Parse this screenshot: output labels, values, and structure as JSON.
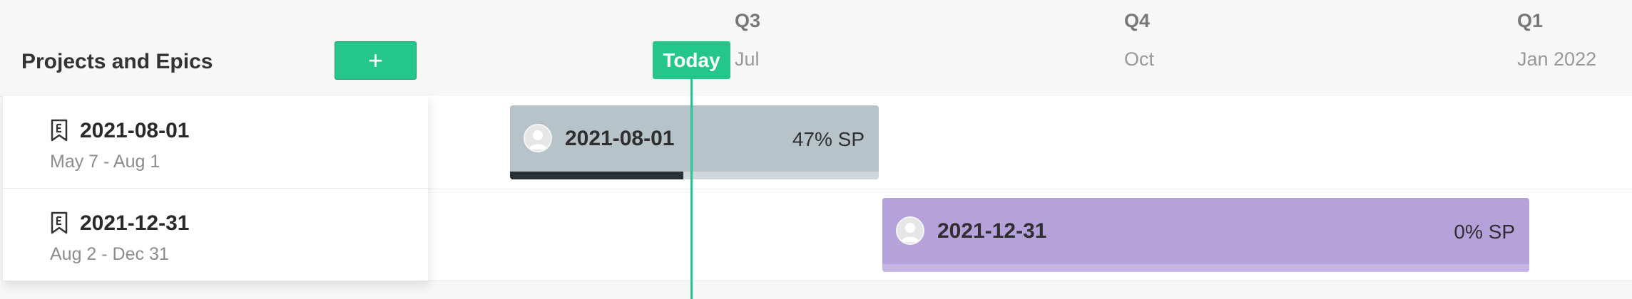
{
  "panel": {
    "title": "Projects and Epics",
    "add_label": "+"
  },
  "timeline": {
    "quarters": [
      {
        "label": "Q3",
        "month": "Jul"
      },
      {
        "label": "Q4",
        "month": "Oct"
      },
      {
        "label": "Q1",
        "month": "Jan 2022"
      }
    ],
    "today_label": "Today"
  },
  "epics": [
    {
      "name": "2021-08-01",
      "dates": "May 7 - Aug 1",
      "icon": "epic-bookmark-icon",
      "bar_label": "2021-08-01",
      "sp_text": "47% SP",
      "progress": 0.47,
      "bar_color": "#b6c3c9",
      "track_color": "#cfd7db",
      "fill_color": "#2a3033"
    },
    {
      "name": "2021-12-31",
      "dates": "Aug 2 - Dec 31",
      "icon": "epic-bookmark-icon",
      "bar_label": "2021-12-31",
      "sp_text": "0% SP",
      "progress": 0.0,
      "bar_color": "#b6a2da",
      "track_color": "#c6b6e5",
      "fill_color": "#5a3f8a"
    }
  ],
  "colors": {
    "accent": "#24c68b"
  }
}
